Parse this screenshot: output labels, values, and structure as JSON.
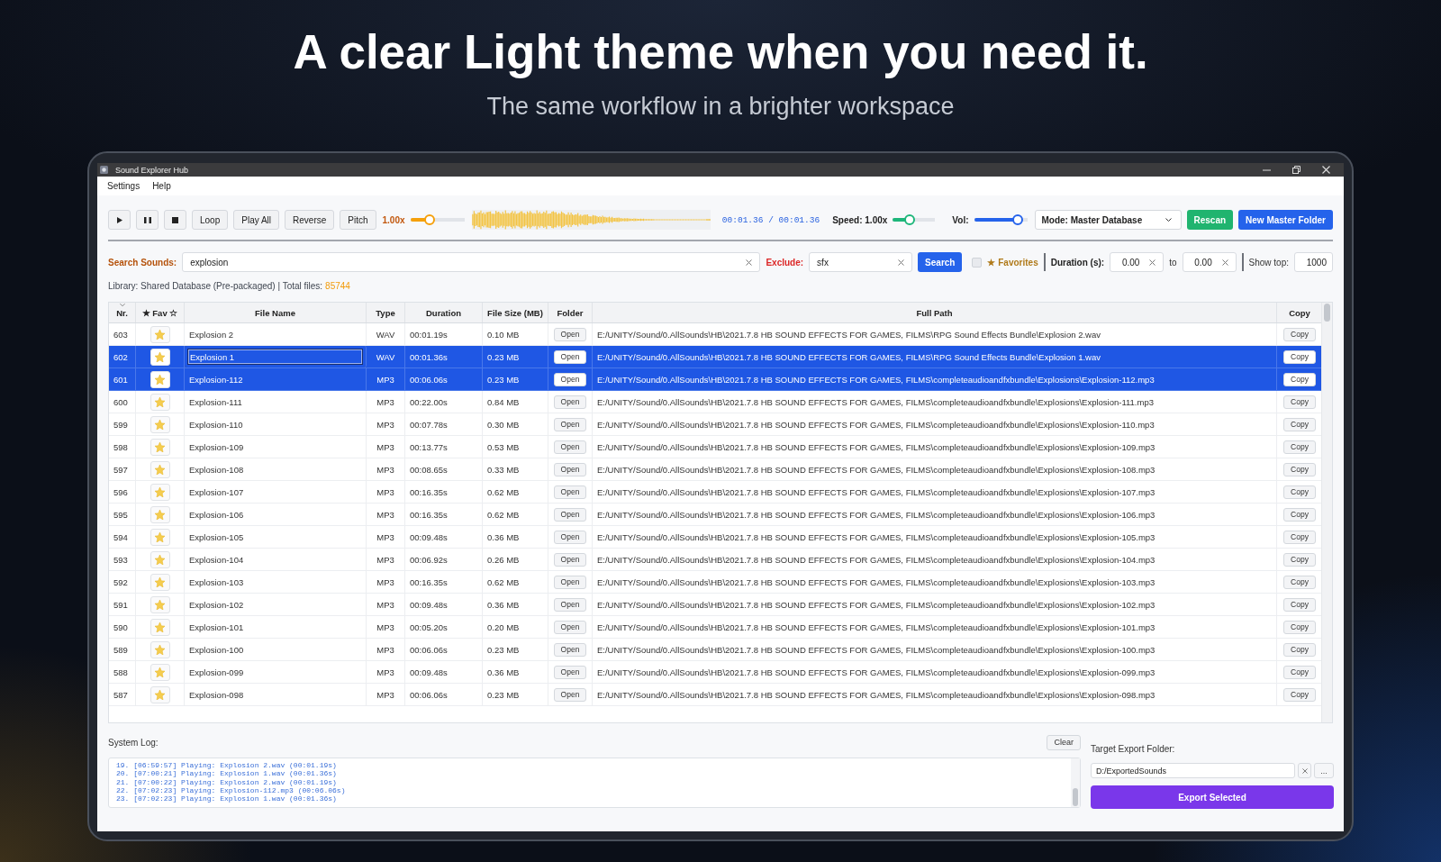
{
  "hero": {
    "title": "A clear Light theme when you need it.",
    "subtitle": "The same workflow in a brighter workspace"
  },
  "window": {
    "title": "Sound Explorer Hub"
  },
  "menu": [
    "Settings",
    "Help"
  ],
  "transport": [
    {
      "kind": "play"
    },
    {
      "kind": "pause"
    },
    {
      "kind": "stop"
    },
    {
      "kind": "text",
      "label": "Loop"
    },
    {
      "kind": "text",
      "label": "Play All"
    },
    {
      "kind": "text",
      "label": "Reverse"
    },
    {
      "kind": "text",
      "label": "Pitch"
    }
  ],
  "pitch": {
    "reading": "1.00x",
    "level": 0.32
  },
  "time": "00:01.36 / 00:01.36",
  "speed": {
    "label": "Speed: 1.00x",
    "level": 0.35
  },
  "volume": {
    "label": "Vol:",
    "level": 0.9
  },
  "mode_select": {
    "value": "Mode: Master Database"
  },
  "actions": [
    {
      "kind": "success",
      "label": "Rescan"
    },
    {
      "kind": "primary",
      "label": "New Master Folder"
    }
  ],
  "search": {
    "label": "Search Sounds:",
    "value": "explosion"
  },
  "exclude": {
    "label": "Exclude:",
    "value": "sfx"
  },
  "search_button": "Search",
  "favorites": {
    "label": "★ Favorites",
    "checked": false
  },
  "duration": {
    "label": "Duration (s):",
    "from": "0.00",
    "to_label": "to",
    "to": "0.00"
  },
  "show_top": {
    "label": "Show top:",
    "value": "1000"
  },
  "library": {
    "text": "Library: Shared Database (Pre-packaged) | Total files:",
    "count": "85744"
  },
  "table": {
    "columns": [
      {
        "label": "Nr.",
        "sorted": true
      },
      {
        "label": "★ Fav ☆",
        "sorted": false
      },
      {
        "label": "File Name",
        "sorted": false
      },
      {
        "label": "Type",
        "sorted": false
      },
      {
        "label": "Duration",
        "sorted": false
      },
      {
        "label": "File Size (MB)",
        "sorted": false
      },
      {
        "label": "Folder",
        "sorted": false
      },
      {
        "label": "Full Path",
        "sorted": false
      },
      {
        "label": "Copy",
        "sorted": false
      }
    ],
    "rows": [
      {
        "nr": "603",
        "name": "Explosion 2",
        "type": "WAV",
        "duration": "00:01.19s",
        "size": "0.10 MB",
        "open": "Open",
        "path": "E:/UNITY/Sound/0.AllSounds\\HB\\2021.7.8 HB SOUND EFFECTS FOR GAMES, FILMS\\RPG Sound Effects Bundle\\Explosion 2.wav",
        "copy": "Copy",
        "selected": false,
        "editing": false
      },
      {
        "nr": "602",
        "name": "Explosion 1",
        "type": "WAV",
        "duration": "00:01.36s",
        "size": "0.23 MB",
        "open": "Open",
        "path": "E:/UNITY/Sound/0.AllSounds\\HB\\2021.7.8 HB SOUND EFFECTS FOR GAMES, FILMS\\RPG Sound Effects Bundle\\Explosion 1.wav",
        "copy": "Copy",
        "selected": true,
        "editing": true
      },
      {
        "nr": "601",
        "name": "Explosion-112",
        "type": "MP3",
        "duration": "00:06.06s",
        "size": "0.23 MB",
        "open": "Open",
        "path": "E:/UNITY/Sound/0.AllSounds\\HB\\2021.7.8 HB SOUND EFFECTS FOR GAMES, FILMS\\completeaudioandfxbundle\\Explosions\\Explosion-112.mp3",
        "copy": "Copy",
        "selected": true,
        "editing": false
      },
      {
        "nr": "600",
        "name": "Explosion-111",
        "type": "MP3",
        "duration": "00:22.00s",
        "size": "0.84 MB",
        "open": "Open",
        "path": "E:/UNITY/Sound/0.AllSounds\\HB\\2021.7.8 HB SOUND EFFECTS FOR GAMES, FILMS\\completeaudioandfxbundle\\Explosions\\Explosion-111.mp3",
        "copy": "Copy",
        "selected": false,
        "editing": false
      },
      {
        "nr": "599",
        "name": "Explosion-110",
        "type": "MP3",
        "duration": "00:07.78s",
        "size": "0.30 MB",
        "open": "Open",
        "path": "E:/UNITY/Sound/0.AllSounds\\HB\\2021.7.8 HB SOUND EFFECTS FOR GAMES, FILMS\\completeaudioandfxbundle\\Explosions\\Explosion-110.mp3",
        "copy": "Copy",
        "selected": false,
        "editing": false
      },
      {
        "nr": "598",
        "name": "Explosion-109",
        "type": "MP3",
        "duration": "00:13.77s",
        "size": "0.53 MB",
        "open": "Open",
        "path": "E:/UNITY/Sound/0.AllSounds\\HB\\2021.7.8 HB SOUND EFFECTS FOR GAMES, FILMS\\completeaudioandfxbundle\\Explosions\\Explosion-109.mp3",
        "copy": "Copy",
        "selected": false,
        "editing": false
      },
      {
        "nr": "597",
        "name": "Explosion-108",
        "type": "MP3",
        "duration": "00:08.65s",
        "size": "0.33 MB",
        "open": "Open",
        "path": "E:/UNITY/Sound/0.AllSounds\\HB\\2021.7.8 HB SOUND EFFECTS FOR GAMES, FILMS\\completeaudioandfxbundle\\Explosions\\Explosion-108.mp3",
        "copy": "Copy",
        "selected": false,
        "editing": false
      },
      {
        "nr": "596",
        "name": "Explosion-107",
        "type": "MP3",
        "duration": "00:16.35s",
        "size": "0.62 MB",
        "open": "Open",
        "path": "E:/UNITY/Sound/0.AllSounds\\HB\\2021.7.8 HB SOUND EFFECTS FOR GAMES, FILMS\\completeaudioandfxbundle\\Explosions\\Explosion-107.mp3",
        "copy": "Copy",
        "selected": false,
        "editing": false
      },
      {
        "nr": "595",
        "name": "Explosion-106",
        "type": "MP3",
        "duration": "00:16.35s",
        "size": "0.62 MB",
        "open": "Open",
        "path": "E:/UNITY/Sound/0.AllSounds\\HB\\2021.7.8 HB SOUND EFFECTS FOR GAMES, FILMS\\completeaudioandfxbundle\\Explosions\\Explosion-106.mp3",
        "copy": "Copy",
        "selected": false,
        "editing": false
      },
      {
        "nr": "594",
        "name": "Explosion-105",
        "type": "MP3",
        "duration": "00:09.48s",
        "size": "0.36 MB",
        "open": "Open",
        "path": "E:/UNITY/Sound/0.AllSounds\\HB\\2021.7.8 HB SOUND EFFECTS FOR GAMES, FILMS\\completeaudioandfxbundle\\Explosions\\Explosion-105.mp3",
        "copy": "Copy",
        "selected": false,
        "editing": false
      },
      {
        "nr": "593",
        "name": "Explosion-104",
        "type": "MP3",
        "duration": "00:06.92s",
        "size": "0.26 MB",
        "open": "Open",
        "path": "E:/UNITY/Sound/0.AllSounds\\HB\\2021.7.8 HB SOUND EFFECTS FOR GAMES, FILMS\\completeaudioandfxbundle\\Explosions\\Explosion-104.mp3",
        "copy": "Copy",
        "selected": false,
        "editing": false
      },
      {
        "nr": "592",
        "name": "Explosion-103",
        "type": "MP3",
        "duration": "00:16.35s",
        "size": "0.62 MB",
        "open": "Open",
        "path": "E:/UNITY/Sound/0.AllSounds\\HB\\2021.7.8 HB SOUND EFFECTS FOR GAMES, FILMS\\completeaudioandfxbundle\\Explosions\\Explosion-103.mp3",
        "copy": "Copy",
        "selected": false,
        "editing": false
      },
      {
        "nr": "591",
        "name": "Explosion-102",
        "type": "MP3",
        "duration": "00:09.48s",
        "size": "0.36 MB",
        "open": "Open",
        "path": "E:/UNITY/Sound/0.AllSounds\\HB\\2021.7.8 HB SOUND EFFECTS FOR GAMES, FILMS\\completeaudioandfxbundle\\Explosions\\Explosion-102.mp3",
        "copy": "Copy",
        "selected": false,
        "editing": false
      },
      {
        "nr": "590",
        "name": "Explosion-101",
        "type": "MP3",
        "duration": "00:05.20s",
        "size": "0.20 MB",
        "open": "Open",
        "path": "E:/UNITY/Sound/0.AllSounds\\HB\\2021.7.8 HB SOUND EFFECTS FOR GAMES, FILMS\\completeaudioandfxbundle\\Explosions\\Explosion-101.mp3",
        "copy": "Copy",
        "selected": false,
        "editing": false
      },
      {
        "nr": "589",
        "name": "Explosion-100",
        "type": "MP3",
        "duration": "00:06.06s",
        "size": "0.23 MB",
        "open": "Open",
        "path": "E:/UNITY/Sound/0.AllSounds\\HB\\2021.7.8 HB SOUND EFFECTS FOR GAMES, FILMS\\completeaudioandfxbundle\\Explosions\\Explosion-100.mp3",
        "copy": "Copy",
        "selected": false,
        "editing": false
      },
      {
        "nr": "588",
        "name": "Explosion-099",
        "type": "MP3",
        "duration": "00:09.48s",
        "size": "0.36 MB",
        "open": "Open",
        "path": "E:/UNITY/Sound/0.AllSounds\\HB\\2021.7.8 HB SOUND EFFECTS FOR GAMES, FILMS\\completeaudioandfxbundle\\Explosions\\Explosion-099.mp3",
        "copy": "Copy",
        "selected": false,
        "editing": false
      },
      {
        "nr": "587",
        "name": "Explosion-098",
        "type": "MP3",
        "duration": "00:06.06s",
        "size": "0.23 MB",
        "open": "Open",
        "path": "E:/UNITY/Sound/0.AllSounds\\HB\\2021.7.8 HB SOUND EFFECTS FOR GAMES, FILMS\\completeaudioandfxbundle\\Explosions\\Explosion-098.mp3",
        "copy": "Copy",
        "selected": false,
        "editing": false
      }
    ]
  },
  "log": {
    "label": "System Log:",
    "clear": "Clear",
    "lines": [
      "19. [06:59:57] Playing: Explosion 2.wav (00:01.19s)",
      "20. [07:00:21] Playing: Explosion 1.wav (00:01.36s)",
      "21. [07:00:22] Playing: Explosion 2.wav (00:01.19s)",
      "22. [07:02:23] Playing: Explosion-112.mp3 (00:06.06s)",
      "23. [07:02:23] Playing: Explosion 1.wav (00:01.36s)"
    ]
  },
  "export": {
    "label": "Target Export Folder:",
    "value": "D:/ExportedSounds",
    "browse": "...",
    "button": "Export Selected"
  }
}
